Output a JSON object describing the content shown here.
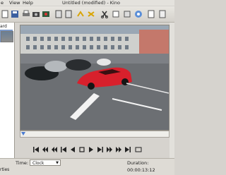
{
  "menubar": {
    "items": [
      {
        "label": "e"
      },
      {
        "label": "View"
      },
      {
        "label": "Help"
      }
    ],
    "title": "Untitled (modified) - Kino"
  },
  "left_panel": {
    "label": "ard",
    "bottom_label": "rties"
  },
  "toolbar": {
    "icons": [
      "new-document-icon",
      "save-icon",
      "print-icon",
      "camera-icon",
      "record-icon",
      "undo-icon",
      "redo-icon",
      "cut-icon",
      "copy-icon",
      "paste-icon",
      "zoom-icon",
      "settings-icon",
      "prefs-icon"
    ]
  },
  "status": {
    "time_label": "Time:",
    "time_format": "Clock",
    "duration": "Duration: 00:00:13:12"
  },
  "colors": {
    "accent": "#4a7bd0",
    "car_red": "#d8202c"
  }
}
